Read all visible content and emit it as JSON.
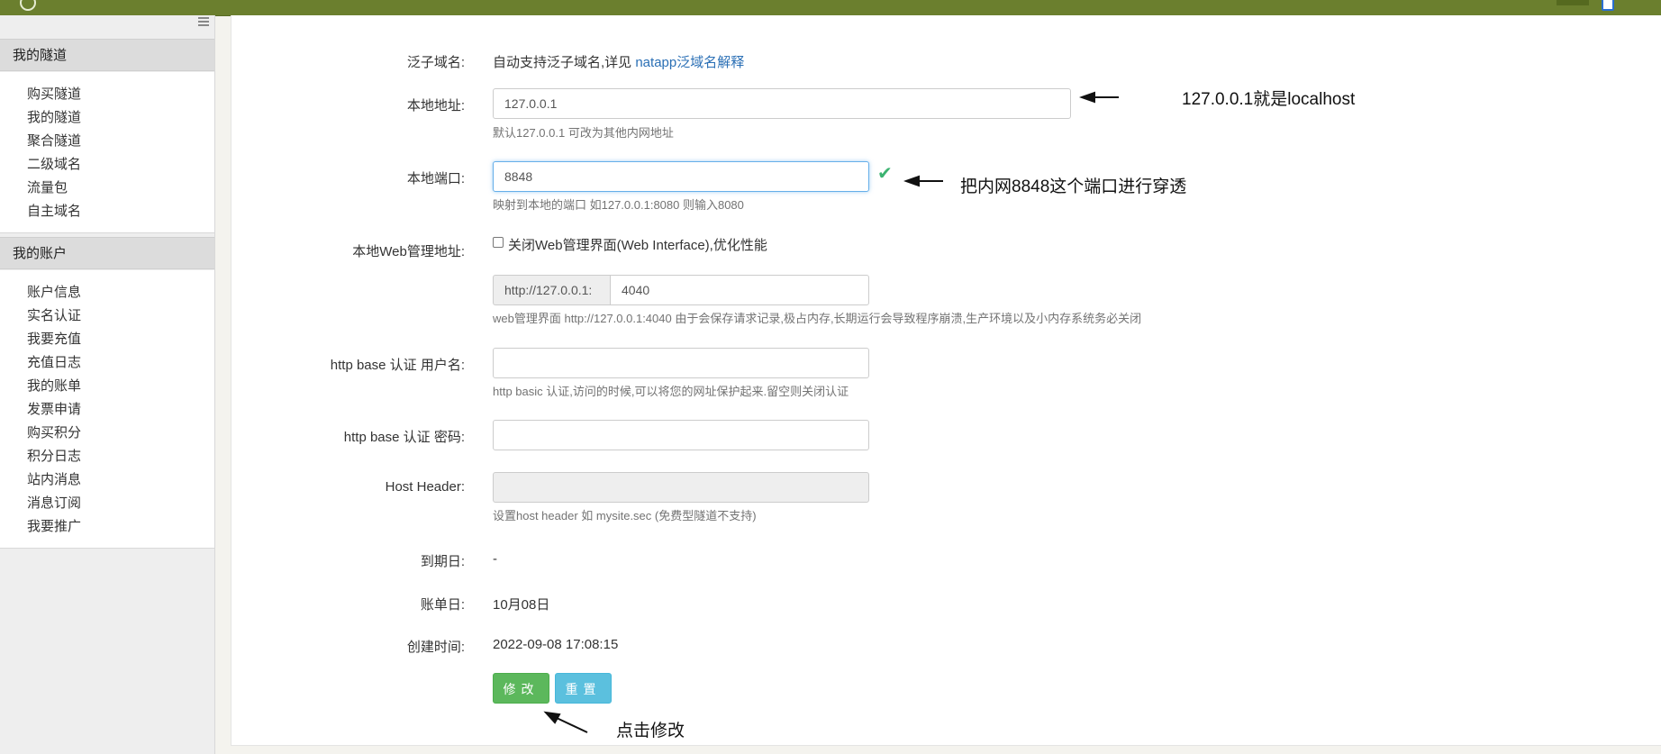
{
  "sidebar": {
    "section1_title": "我的隧道",
    "section1_items": [
      "购买隧道",
      "我的隧道",
      "聚合隧道",
      "二级域名",
      "流量包",
      "自主域名"
    ],
    "section2_title": "我的账户",
    "section2_items": [
      "账户信息",
      "实名认证",
      "我要充值",
      "充值日志",
      "我的账单",
      "发票申请",
      "购买积分",
      "积分日志",
      "站内消息",
      "消息订阅",
      "我要推广"
    ]
  },
  "form": {
    "wildcard_label": "泛子域名:",
    "wildcard_text": "自动支持泛子域名,详见",
    "wildcard_link": "natapp泛域名解释",
    "local_addr_label": "本地地址:",
    "local_addr_value": "127.0.0.1",
    "local_addr_help": "默认127.0.0.1 可改为其他内网地址",
    "local_port_label": "本地端口:",
    "local_port_value": "8848",
    "local_port_help": "映射到本地的端口 如127.0.0.1:8080 则输入8080",
    "web_admin_label": "本地Web管理地址:",
    "web_admin_checkbox_label": "关闭Web管理界面(Web Interface),优化性能",
    "web_admin_prefix": "http://127.0.0.1:",
    "web_admin_port": "4040",
    "web_admin_help": "web管理界面 http://127.0.0.1:4040 由于会保存请求记录,极占内存,长期运行会导致程序崩溃,生产环境以及小内存系统务必关闭",
    "basic_user_label": "http base 认证 用户名:",
    "basic_user_value": "",
    "basic_user_help": "http basic 认证,访问的时候,可以将您的网址保护起来.留空则关闭认证",
    "basic_pass_label": "http base 认证 密码:",
    "basic_pass_value": "",
    "host_header_label": "Host Header:",
    "host_header_value": "",
    "host_header_help": "设置host header 如 mysite.sec (免费型隧道不支持)",
    "expire_label": "到期日:",
    "expire_value": "-",
    "bill_label": "账单日:",
    "bill_value": "10月08日",
    "created_label": "创建时间:",
    "created_value": "2022-09-08 17:08:15",
    "modify_button": "修改",
    "reset_button": "重置"
  },
  "annotations": {
    "local_addr_note": "127.0.0.1就是localhost",
    "local_port_note": "把内网8848这个端口进行穿透",
    "click_note": "点击修改"
  },
  "colors": {
    "topbar": "#6b7f2e",
    "link": "#2a6fb5",
    "modify_button": "#5cb85c",
    "reset_button": "#5bc0de",
    "check": "#3cb371"
  }
}
